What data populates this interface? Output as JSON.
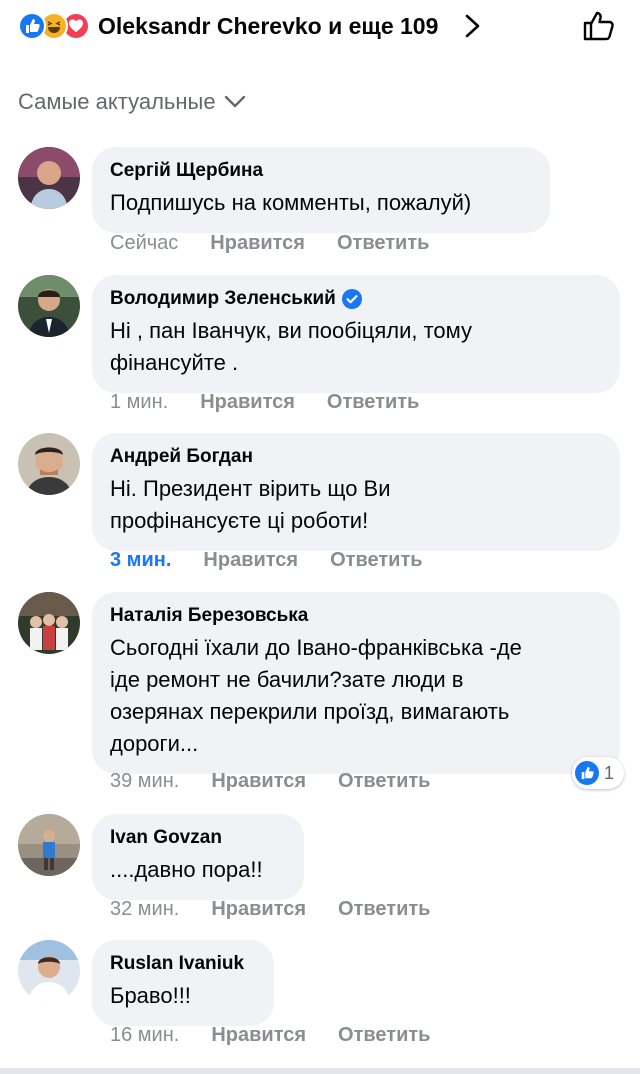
{
  "header": {
    "reactors_text": "Oleksandr Cherevko и еще 109",
    "reaction_icons": [
      "like-icon",
      "haha-icon",
      "love-icon"
    ]
  },
  "sort": {
    "label": "Самые актуальные"
  },
  "colors": {
    "accent": "#1877f2",
    "bubble": "#f0f2f5",
    "muted": "#65676b"
  },
  "comments": [
    {
      "author": "Сергій Щербина",
      "lines": [
        "Подпишусь на комменты, пожалуй)"
      ],
      "time": "Сейчас",
      "like": "Нравится",
      "reply": "Ответить"
    },
    {
      "author": "Володимир Зеленський",
      "verified": true,
      "lines": [
        "Ні , пан Іванчук, ви пообіцяли, тому",
        "фінансуйте ."
      ],
      "time": "1 мин.",
      "like": "Нравится",
      "reply": "Ответить"
    },
    {
      "author": "Андрей Богдан",
      "lines": [
        "Ні. Президент вірить що Ви",
        "профінансуєте ці роботи!"
      ],
      "time": "3 мин.",
      "like": "Нравится",
      "reply": "Ответить"
    },
    {
      "author": "Наталія Березовська",
      "lines": [
        "Сьогодні їхали до Івано-франківська -де",
        "іде ремонт не бачили?зате люди в",
        "озерянах перекрили проїзд, вимагають",
        "дороги..."
      ],
      "time": "39 мин.",
      "like": "Нравится",
      "reply": "Ответить",
      "reactions": "1"
    },
    {
      "author": "Ivan Govzan",
      "lines": [
        "....давно пора!!"
      ],
      "time": "32 мин.",
      "like": "Нравится",
      "reply": "Ответить"
    },
    {
      "author": "Ruslan Ivaniuk",
      "lines": [
        "Браво!!!"
      ],
      "time": "16 мин.",
      "like": "Нравится",
      "reply": "Ответить"
    }
  ]
}
